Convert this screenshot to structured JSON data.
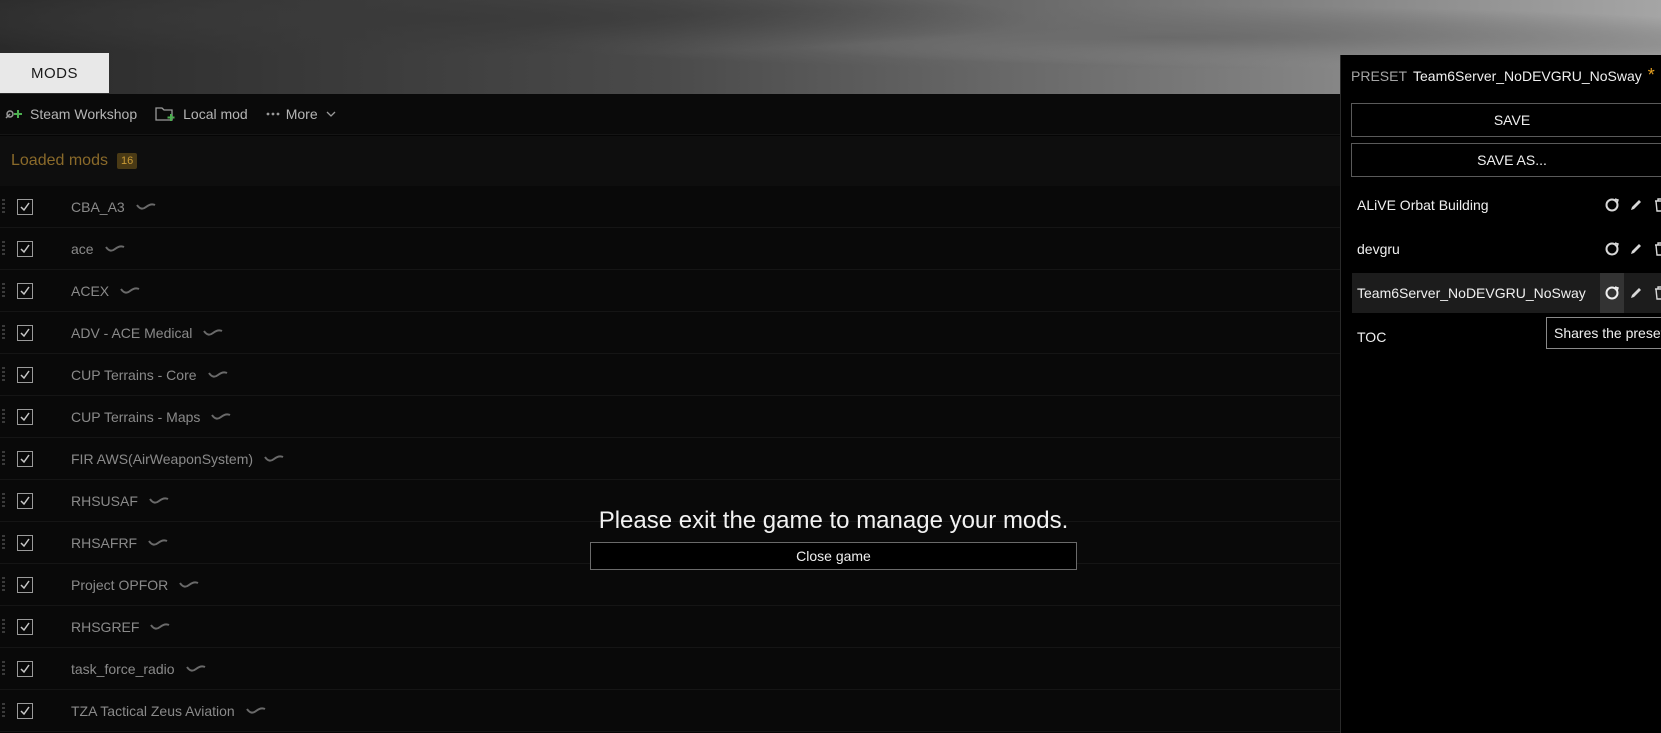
{
  "header": {
    "tab_label": "MODS"
  },
  "toolbar": {
    "steam_workshop": "Steam Workshop",
    "local_mod": "Local mod",
    "more": "More"
  },
  "loaded": {
    "title": "Loaded mods",
    "count": "16"
  },
  "mods": [
    {
      "name": "CBA_A3"
    },
    {
      "name": "ace"
    },
    {
      "name": "ACEX"
    },
    {
      "name": "ADV - ACE Medical"
    },
    {
      "name": "CUP Terrains - Core"
    },
    {
      "name": "CUP Terrains - Maps"
    },
    {
      "name": "FIR AWS(AirWeaponSystem)"
    },
    {
      "name": "RHSUSAF"
    },
    {
      "name": "RHSAFRF"
    },
    {
      "name": "Project OPFOR"
    },
    {
      "name": "RHSGREF"
    },
    {
      "name": "task_force_radio"
    },
    {
      "name": "TZA Tactical Zeus Aviation"
    }
  ],
  "overlay": {
    "message": "Please exit the game to manage your mods.",
    "close_button": "Close game"
  },
  "preset": {
    "label": "PRESET",
    "current": "Team6Server_NoDEVGRU_NoSway",
    "modified_marker": "*",
    "save": "SAVE",
    "save_as": "SAVE AS...",
    "items": [
      {
        "name": "ALiVE Orbat Building"
      },
      {
        "name": "devgru"
      },
      {
        "name": "Team6Server_NoDEVGRU_NoSway"
      },
      {
        "name": "TOC"
      }
    ],
    "tooltip": "Shares the preset"
  },
  "colors": {
    "accent_gold": "#e6a021",
    "loaded_title": "#8a6a2a"
  }
}
